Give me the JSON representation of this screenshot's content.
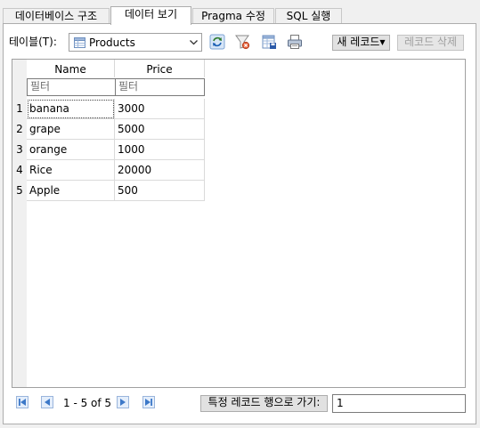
{
  "tabs": [
    {
      "label": "데이터베이스 구조"
    },
    {
      "label": "데이터 보기"
    },
    {
      "label": "Pragma 수정"
    },
    {
      "label": "SQL 실행"
    }
  ],
  "active_tab": 1,
  "toolbar": {
    "table_label": "테이블(T):",
    "table_selected": "Products",
    "new_record_label": "새 레코드",
    "delete_record_label": "레코드 삭제"
  },
  "grid": {
    "columns": [
      {
        "name": "Name",
        "filter_placeholder": "필터"
      },
      {
        "name": "Price",
        "filter_placeholder": "필터"
      }
    ],
    "rows": [
      {
        "num": "1",
        "name": "banana",
        "price": "3000"
      },
      {
        "num": "2",
        "name": "grape",
        "price": "5000"
      },
      {
        "num": "3",
        "name": "orange",
        "price": "1000"
      },
      {
        "num": "4",
        "name": "Rice",
        "price": "20000"
      },
      {
        "num": "5",
        "name": "Apple",
        "price": "500"
      }
    ]
  },
  "footer": {
    "page_info": "1 - 5 of 5",
    "goto_label": "특정 레코드 행으로 가기:",
    "goto_value": "1"
  },
  "icons": {
    "refresh": "refresh-icon",
    "clear_filters": "clear-filters-icon",
    "save_table": "save-table-icon",
    "print": "print-icon",
    "nav_first": "first-page-icon",
    "nav_prev": "previous-page-icon",
    "nav_next": "next-page-icon",
    "nav_last": "last-page-icon"
  },
  "colors": {
    "accent": "#1a5fb4",
    "nav_blue": "#3c78c8"
  }
}
